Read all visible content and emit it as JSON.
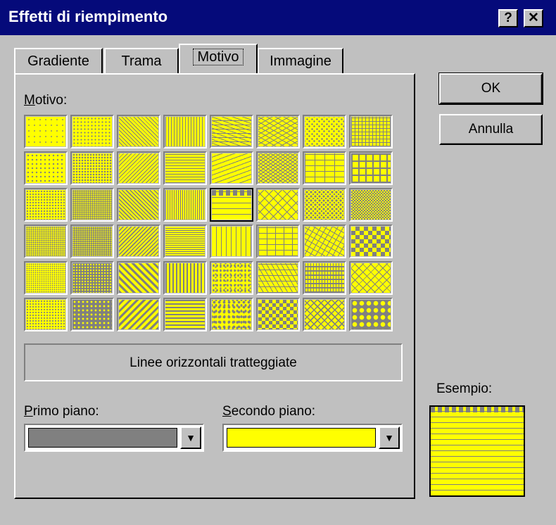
{
  "window": {
    "title": "Effetti di riempimento",
    "help_label": "?",
    "close_label": "✕"
  },
  "tabs": [
    {
      "label": "Gradiente",
      "active": false
    },
    {
      "label": "Trama",
      "active": false
    },
    {
      "label": "Motivo",
      "active": true
    },
    {
      "label": "Immagine",
      "active": false
    }
  ],
  "pattern_section": {
    "label_accel": "M",
    "label_rest": "otivo:",
    "selected_index": 20,
    "selected_name": "Linee orizzontali tratteggiate"
  },
  "foreground": {
    "label_accel": "P",
    "label_rest": "rimo piano:",
    "color": "#808080"
  },
  "background": {
    "label_accel": "S",
    "label_rest": "econdo piano:",
    "color": "#ffff00"
  },
  "buttons": {
    "ok": "OK",
    "cancel": "Annulla"
  },
  "preview": {
    "label": "Esempio:"
  },
  "patterns": [
    "dots-5",
    "dots-10",
    "diag-thin-down",
    "vert-thin",
    "wave-h",
    "zigzag",
    "trellis-dots",
    "grid-small",
    "dots-20",
    "dots-25",
    "diag-thin-up",
    "horiz-thin",
    "diag-dashed",
    "zigzag-dense",
    "grid-dots",
    "grid-large",
    "dots-30",
    "dots-40",
    "diag-medium-down",
    "vert-medium",
    "horiz-dashed",
    "diag-brick",
    "sphere",
    "checker-small",
    "dots-50",
    "dots-60",
    "diag-medium-up",
    "horiz-medium",
    "vert-dashed",
    "brick-h",
    "weave",
    "checker-large",
    "dots-70",
    "dots-75",
    "diag-wide-down",
    "vert-wide",
    "confetti-small",
    "shingle",
    "plaid",
    "diamond-outline",
    "dots-80",
    "dots-90",
    "diag-wide-up",
    "horiz-wide",
    "confetti-large",
    "checker-dotted",
    "diamond-dotted",
    "diamond-solid"
  ]
}
